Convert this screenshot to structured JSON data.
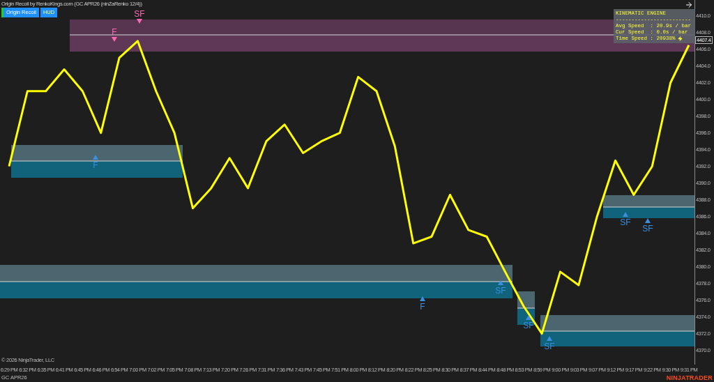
{
  "header": {
    "title": "Origin Recoil by RenkoKings.com (GC APR26 (ninZaRenko 12/4))"
  },
  "toolbar": [
    {
      "label": "Origin Recoil",
      "kind": "primary",
      "on": true
    },
    {
      "label": "HUD",
      "kind": "toggle",
      "on": true
    }
  ],
  "hud": {
    "title": "KINEMATIC ENGINE",
    "separator": "------------------------",
    "lines": [
      "Avg Speed  : 20.9s / bar",
      "Cur Speed  : 0.0s / bar",
      "Time Speed : 20938%"
    ]
  },
  "chart": {
    "current_price": "4407.4",
    "chart_data": {
      "type": "line",
      "categories": [
        "6:29 PM",
        "6:32 PM",
        "6:35 PM",
        "6:41 PM",
        "6:45 PM",
        "6:46 PM",
        "6:54 PM",
        "7:00 PM",
        "7:02 PM",
        "7:05 PM",
        "7:08 PM",
        "7:13 PM",
        "7:20 PM",
        "7:26 PM",
        "7:31 PM",
        "7:36 PM",
        "7:43 PM",
        "7:45 PM",
        "7:51 PM",
        "8:00 PM",
        "8:12 PM",
        "8:20 PM",
        "8:22 PM",
        "8:25 PM",
        "8:30 PM",
        "8:37 PM",
        "8:44 PM",
        "8:48 PM",
        "8:53 PM",
        "8:59 PM",
        "9:00 PM",
        "9:03 PM",
        "9:07 PM",
        "9:12 PM",
        "9:17 PM",
        "9:22 PM",
        "9:30 PM",
        "9:31 PM"
      ],
      "series": [
        {
          "name": "GC APR26",
          "color": "#ffff00",
          "values": [
            4392,
            4401,
            4401,
            4403.6,
            4401,
            4396,
            4405,
            4407,
            4401,
            4396,
            4387,
            4389.4,
            4393,
            4389.4,
            4395,
            4397,
            4393.6,
            4395,
            4396,
            4402.7,
            4401,
            4394.4,
            4382.8,
            4383.6,
            4388.6,
            4384.4,
            4383.6,
            4379.4,
            4375.3,
            4372,
            4379.4,
            4377.8,
            4386,
            4392.7,
            4388.6,
            4392,
            4402,
            4406.5
          ]
        }
      ],
      "ylim": [
        4368.3,
        4411.9
      ],
      "yticks": [
        {
          "value": 4410,
          "label": "4410.0"
        },
        {
          "value": 4408,
          "label": "4408.0"
        },
        {
          "value": 4406,
          "label": "4406.0"
        },
        {
          "value": 4404,
          "label": "4404.0"
        },
        {
          "value": 4402,
          "label": "4402.0"
        },
        {
          "value": 4400,
          "label": "4400.0"
        },
        {
          "value": 4398,
          "label": "4398.0"
        },
        {
          "value": 4396,
          "label": "4396.0"
        },
        {
          "value": 4394,
          "label": "4394.0"
        },
        {
          "value": 4392,
          "label": "4392.0"
        },
        {
          "value": 4390,
          "label": "4390.0"
        },
        {
          "value": 4388,
          "label": "4388.0"
        },
        {
          "value": 4386,
          "label": "4386.0"
        },
        {
          "value": 4384,
          "label": "4384.0"
        },
        {
          "value": 4382,
          "label": "4382.0"
        },
        {
          "value": 4380,
          "label": "4380.0"
        },
        {
          "value": 4378,
          "label": "4378.0"
        },
        {
          "value": 4376,
          "label": "4376.0"
        },
        {
          "value": 4374,
          "label": "4374.0"
        },
        {
          "value": 4372,
          "label": "4372.0"
        },
        {
          "value": 4370,
          "label": "4370.0"
        }
      ]
    }
  },
  "signals": [
    {
      "text": "SF",
      "kind": "down"
    },
    {
      "text": "F",
      "kind": "down"
    },
    {
      "text": "F",
      "kind": "up"
    },
    {
      "text": "F",
      "kind": "up"
    },
    {
      "text": "SF",
      "kind": "up"
    },
    {
      "text": "SF",
      "kind": "up"
    },
    {
      "text": "SF",
      "kind": "up"
    },
    {
      "text": "SF",
      "kind": "up"
    },
    {
      "text": "SF",
      "kind": "up"
    }
  ],
  "footer": {
    "copyright": "© 2026 NinjaTrader, LLC",
    "logo": "NINJATRADER"
  }
}
